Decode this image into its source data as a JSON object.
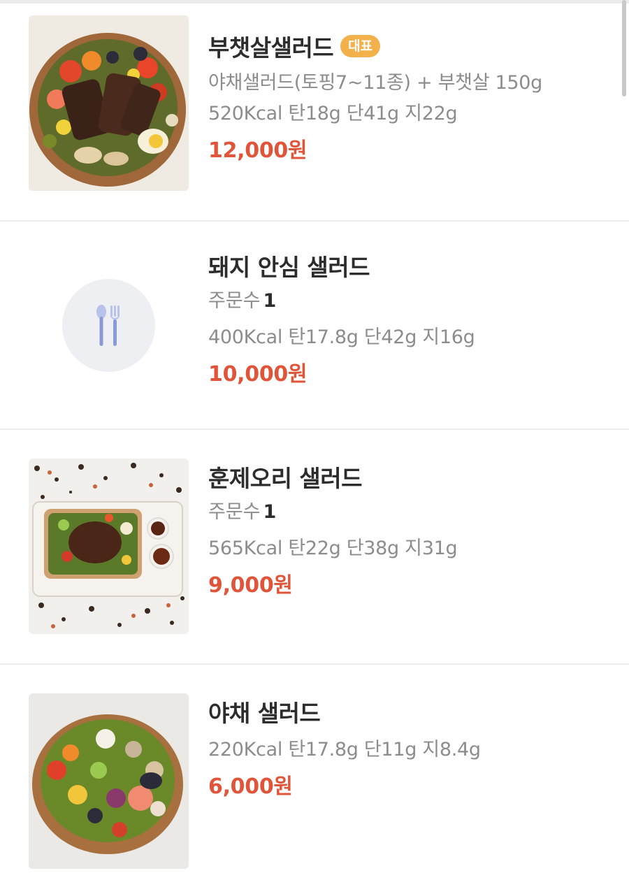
{
  "items": [
    {
      "name": "부챗살샐러드",
      "badge": "대표",
      "description": "야채샐러드(토핑7~11종) + 부챗살 150g",
      "nutrition": "520Kcal 탄18g 단41g 지22g",
      "price": "12,000원",
      "image": "salad-bowl-beef"
    },
    {
      "name": "돼지 안심 샐러드",
      "orders_label": "주문수",
      "orders_count": "1",
      "nutrition": "400Kcal 탄17.8g 단42g 지16g",
      "price": "10,000원",
      "image": "utensils-icon"
    },
    {
      "name": "훈제오리 샐러드",
      "orders_label": "주문수",
      "orders_count": "1",
      "nutrition": "565Kcal 탄22g 단38g 지31g",
      "price": "9,000원",
      "image": "salad-tray-duck"
    },
    {
      "name": "야채 샐러드",
      "nutrition": "220Kcal 탄17.8g 단11g 지8.4g",
      "price": "6,000원",
      "image": "salad-bowl-vegetable"
    }
  ],
  "colors": {
    "price": "#e0553a",
    "badge": "#f2b14a",
    "placeholder_bg": "#eeeff3",
    "utensil": "#8a9ad6"
  }
}
